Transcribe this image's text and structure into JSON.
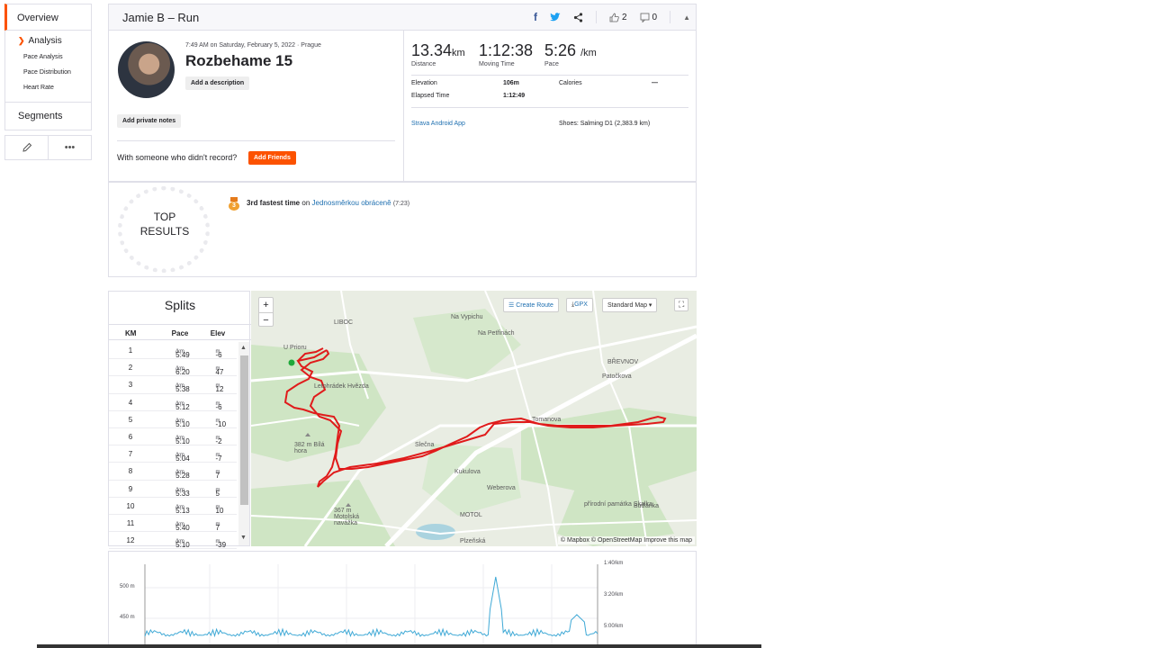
{
  "nav": {
    "overview": "Overview",
    "analysis": "Analysis",
    "sub_items": [
      "Pace Analysis",
      "Pace Distribution",
      "Heart Rate"
    ],
    "segments": "Segments",
    "more": "•••"
  },
  "header": {
    "title": "Jamie B – Run",
    "kudos_count": "2",
    "comment_count": "0"
  },
  "activity": {
    "datetime": "7:49 AM on Saturday, February 5, 2022 · Prague",
    "name": "Rozbehame 15",
    "add_description": "Add a description",
    "add_private_notes": "Add private notes",
    "with_someone": "With someone who didn't record?",
    "add_friends": "Add Friends"
  },
  "stats": {
    "distance": {
      "value": "13.34",
      "unit": "km",
      "label": "Distance"
    },
    "moving_time": {
      "value": "1:12:38",
      "label": "Moving Time"
    },
    "pace": {
      "value": "5:26",
      "unit": "/km",
      "label": "Pace"
    },
    "elevation_label": "Elevation",
    "elevation_value": "106m",
    "calories_label": "Calories",
    "calories_value": "—",
    "elapsed_label": "Elapsed Time",
    "elapsed_value": "1:12:49",
    "device": "Strava Android App",
    "shoes": "Shoes: Salming D1 (2,383.9 km)"
  },
  "top_results": {
    "badge_line1": "TOP",
    "badge_line2": "RESULTS",
    "medal": "3",
    "rank_text": "3rd fastest time",
    "on_text": "on",
    "segment": "Jednosměrkou obráceně",
    "segment_time": "(7:23)"
  },
  "splits": {
    "title": "Splits",
    "headers": [
      "KM",
      "Pace",
      "Elev"
    ],
    "pace_unit": "/km",
    "elev_unit": "m",
    "rows": [
      {
        "km": "1",
        "pace": "5:49",
        "elev": "-6"
      },
      {
        "km": "2",
        "pace": "6:20",
        "elev": "47"
      },
      {
        "km": "3",
        "pace": "5:38",
        "elev": "12"
      },
      {
        "km": "4",
        "pace": "5:12",
        "elev": "-6"
      },
      {
        "km": "5",
        "pace": "5:10",
        "elev": "-10"
      },
      {
        "km": "6",
        "pace": "5:10",
        "elev": "-2"
      },
      {
        "km": "7",
        "pace": "5:04",
        "elev": "-7"
      },
      {
        "km": "8",
        "pace": "5:28",
        "elev": "7"
      },
      {
        "km": "9",
        "pace": "5:33",
        "elev": "5"
      },
      {
        "km": "10",
        "pace": "5:13",
        "elev": "10"
      },
      {
        "km": "11",
        "pace": "5:40",
        "elev": "7"
      },
      {
        "km": "12",
        "pace": "5:10",
        "elev": "-39"
      }
    ]
  },
  "map": {
    "create_route": "Create Route",
    "gpx": "GPX",
    "map_style": "Standard Map",
    "attribution": "© Mapbox © OpenStreetMap Improve this map",
    "labels": {
      "liboc": "LIBOC",
      "brevnov": "BŘEVNOV",
      "motol": "MOTOL",
      "hvezda": "Letohrádek Hvězda",
      "bila_hora": "382 m Bílá hora",
      "motolska": "367 m Motolská navážka",
      "skalka": "přírodní památka Skalka",
      "budanka": "Buďánka",
      "plzenska": "Plzeňská",
      "weberova": "Weberova",
      "kukulova": "Kukulova",
      "slecna": "Slečna",
      "vypich": "Na Vypichu",
      "petrinach": "Na Petřinách",
      "u_prioru": "U Prioru",
      "tomanova": "Tomanova",
      "patockova": "Patočkova"
    }
  },
  "chart": {
    "y_left": [
      "500 m",
      "450 m"
    ],
    "y_right": [
      "1:40/km",
      "3:20/km",
      "5:00/km"
    ],
    "accent": "#3fa9d6"
  },
  "colors": {
    "brand": "#fc5200",
    "route": "#e01b1b",
    "link": "#1e6fb0"
  }
}
